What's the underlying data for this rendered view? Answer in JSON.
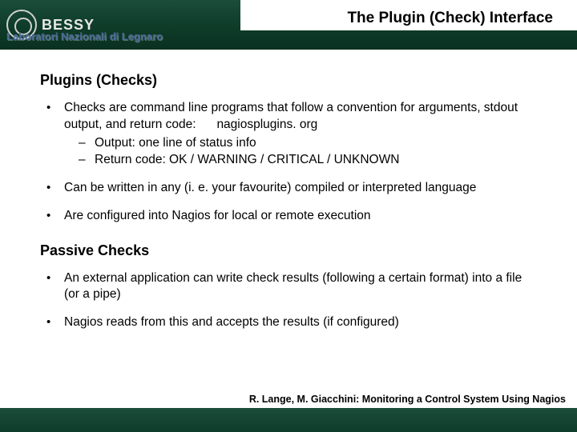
{
  "header": {
    "logo_text": "BESSY",
    "lab_text": "Laboratori Nazionali di Legnaro",
    "title": "The Plugin (Check) Interface"
  },
  "section1": {
    "heading": "Plugins (Checks)",
    "b1_text": "Checks are command line programs that follow a convention for arguments, stdout output, and return code:",
    "b1_link": "nagiosplugins. org",
    "b1_sub1": "Output: one line of status info",
    "b1_sub2": "Return code: OK / WARNING / CRITICAL / UNKNOWN",
    "b2": "Can be written in any (i. e. your favourite) compiled or interpreted language",
    "b3": "Are configured into Nagios for local or remote execution"
  },
  "section2": {
    "heading": "Passive Checks",
    "b1": "An external application can write check results (following a certain format) into a file (or a pipe)",
    "b2": "Nagios reads from this and accepts the results (if configured)"
  },
  "footer": {
    "credit": "R. Lange, M. Giacchini: Monitoring a Control System Using Nagios"
  }
}
